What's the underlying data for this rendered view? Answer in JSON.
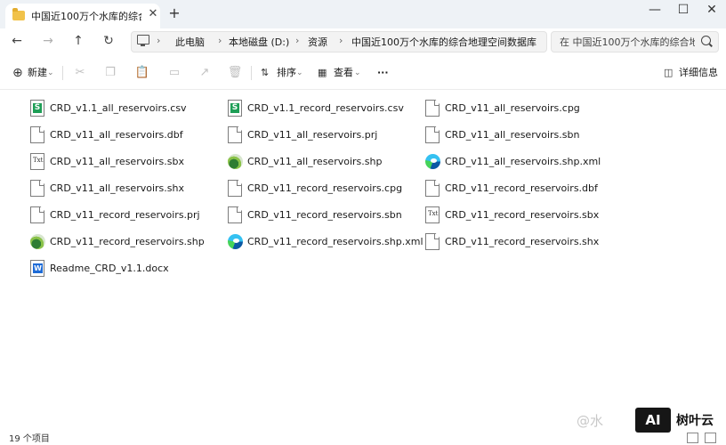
{
  "window": {
    "tab_title": "中国近100万个水库的综合地理",
    "tab_close": "✕",
    "new_tab": "+",
    "minimize": "—",
    "maximize": "☐",
    "close": "✕"
  },
  "nav": {
    "back": "←",
    "forward": "→",
    "up": "↑",
    "refresh": "↻",
    "breadcrumbs": [
      "此电脑",
      "本地磁盘 (D:)",
      "资源",
      "中国近100万个水库的综合地理空间数据库"
    ],
    "separator": "›",
    "search_placeholder": "在 中国近100万个水库的综合地理"
  },
  "toolbar": {
    "new_label": "新建",
    "sort_label": "排序",
    "view_label": "查看",
    "more_label": "···",
    "details_label": "详细信息"
  },
  "files": [
    {
      "name": "CRD_v1.1_all_reservoirs.csv",
      "icon": "csv-icon"
    },
    {
      "name": "CRD_v1.1_record_reservoirs.csv",
      "icon": "csv-icon"
    },
    {
      "name": "CRD_v11_all_reservoirs.cpg",
      "icon": "file-icon"
    },
    {
      "name": "CRD_v11_all_reservoirs.dbf",
      "icon": "file-icon"
    },
    {
      "name": "CRD_v11_all_reservoirs.prj",
      "icon": "file-icon"
    },
    {
      "name": "CRD_v11_all_reservoirs.sbn",
      "icon": "file-icon"
    },
    {
      "name": "CRD_v11_all_reservoirs.sbx",
      "icon": "text-file-icon"
    },
    {
      "name": "CRD_v11_all_reservoirs.shp",
      "icon": "globe-icon"
    },
    {
      "name": "CRD_v11_all_reservoirs.shp.xml",
      "icon": "edge-icon"
    },
    {
      "name": "CRD_v11_all_reservoirs.shx",
      "icon": "file-icon"
    },
    {
      "name": "CRD_v11_record_reservoirs.cpg",
      "icon": "file-icon"
    },
    {
      "name": "CRD_v11_record_reservoirs.dbf",
      "icon": "file-icon"
    },
    {
      "name": "CRD_v11_record_reservoirs.prj",
      "icon": "file-icon"
    },
    {
      "name": "CRD_v11_record_reservoirs.sbn",
      "icon": "file-icon"
    },
    {
      "name": "CRD_v11_record_reservoirs.sbx",
      "icon": "text-file-icon"
    },
    {
      "name": "CRD_v11_record_reservoirs.shp",
      "icon": "globe-icon"
    },
    {
      "name": "CRD_v11_record_reservoirs.shp.xml",
      "icon": "edge-icon"
    },
    {
      "name": "CRD_v11_record_reservoirs.shx",
      "icon": "file-icon"
    },
    {
      "name": "Readme_CRD_v1.1.docx",
      "icon": "word-icon"
    }
  ],
  "status": {
    "count": "19 个项目"
  },
  "watermark": {
    "text": "@水",
    "badge": "AI",
    "brand": "树叶云"
  }
}
